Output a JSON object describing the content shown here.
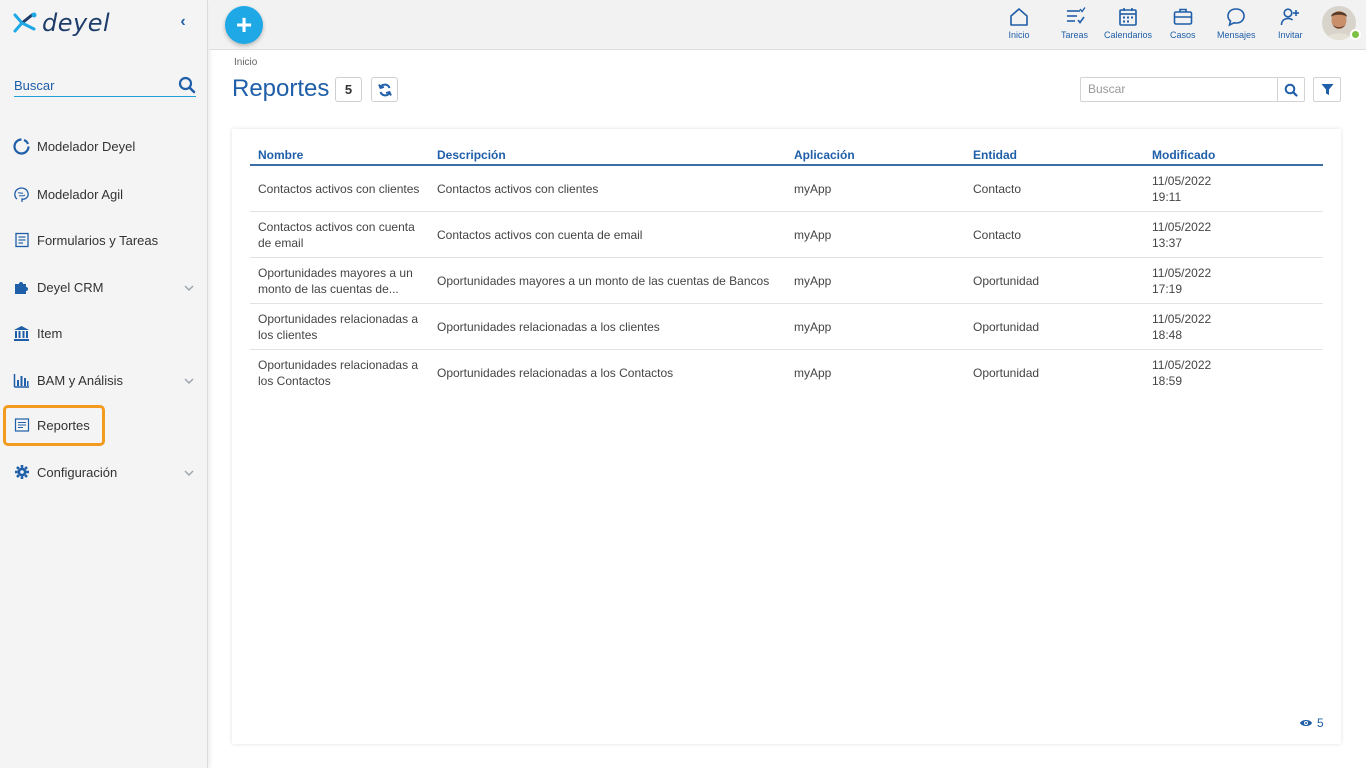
{
  "app": {
    "logo": "deyel"
  },
  "sidebar": {
    "search_placeholder": "Buscar",
    "items": [
      {
        "label": "Modelador Deyel",
        "icon": "circle-notch-icon",
        "has_children": false
      },
      {
        "label": "Modelador Agil",
        "icon": "brain-icon",
        "has_children": false
      },
      {
        "label": "Formularios y Tareas",
        "icon": "form-icon",
        "has_children": false
      },
      {
        "label": "Deyel CRM",
        "icon": "puzzle-icon",
        "has_children": true
      },
      {
        "label": "Item",
        "icon": "bank-icon",
        "has_children": false
      },
      {
        "label": "BAM y Análisis",
        "icon": "bar-chart-icon",
        "has_children": true
      },
      {
        "label": "Reportes",
        "icon": "report-icon",
        "has_children": false,
        "active": true
      },
      {
        "label": "Configuración",
        "icon": "gear-icon",
        "has_children": true
      }
    ]
  },
  "topbar": {
    "items": [
      {
        "label": "Inicio",
        "icon": "home-icon"
      },
      {
        "label": "Tareas",
        "icon": "tasks-icon"
      },
      {
        "label": "Calendarios",
        "icon": "calendar-icon"
      },
      {
        "label": "Casos",
        "icon": "briefcase-icon"
      },
      {
        "label": "Mensajes",
        "icon": "message-icon"
      },
      {
        "label": "Invitar",
        "icon": "invite-user-icon"
      }
    ],
    "user_status_color": "#7ac142"
  },
  "page": {
    "breadcrumb": "Inicio",
    "title": "Reportes",
    "count": "5",
    "search_placeholder": "Buscar",
    "footer_count": "5"
  },
  "table": {
    "headers": [
      "Nombre",
      "Descripción",
      "Aplicación",
      "Entidad",
      "Modificado"
    ],
    "rows": [
      {
        "nombre": "Contactos activos con clientes",
        "descripcion": "Contactos activos con clientes",
        "aplicacion": "myApp",
        "entidad": "Contacto",
        "fecha": "11/05/2022",
        "hora": "19:11"
      },
      {
        "nombre": "Contactos activos con cuenta de email",
        "descripcion": "Contactos activos con cuenta de email",
        "aplicacion": "myApp",
        "entidad": "Contacto",
        "fecha": "11/05/2022",
        "hora": "13:37"
      },
      {
        "nombre": "Oportunidades mayores a un monto de las cuentas de...",
        "descripcion": "Oportunidades mayores a un monto de las cuentas de Bancos",
        "aplicacion": "myApp",
        "entidad": "Oportunidad",
        "fecha": "11/05/2022",
        "hora": "17:19"
      },
      {
        "nombre": "Oportunidades relacionadas a los clientes",
        "descripcion": "Oportunidades relacionadas a los clientes",
        "aplicacion": "myApp",
        "entidad": "Oportunidad",
        "fecha": "11/05/2022",
        "hora": "18:48"
      },
      {
        "nombre": "Oportunidades relacionadas a los Contactos",
        "descripcion": "Oportunidades relacionadas a los Contactos",
        "aplicacion": "myApp",
        "entidad": "Oportunidad",
        "fecha": "11/05/2022",
        "hora": "18:59"
      }
    ]
  },
  "colors": {
    "accent": "#1f5ea8",
    "add_button": "#1fa8e6",
    "active_outline": "#f39b1f"
  }
}
